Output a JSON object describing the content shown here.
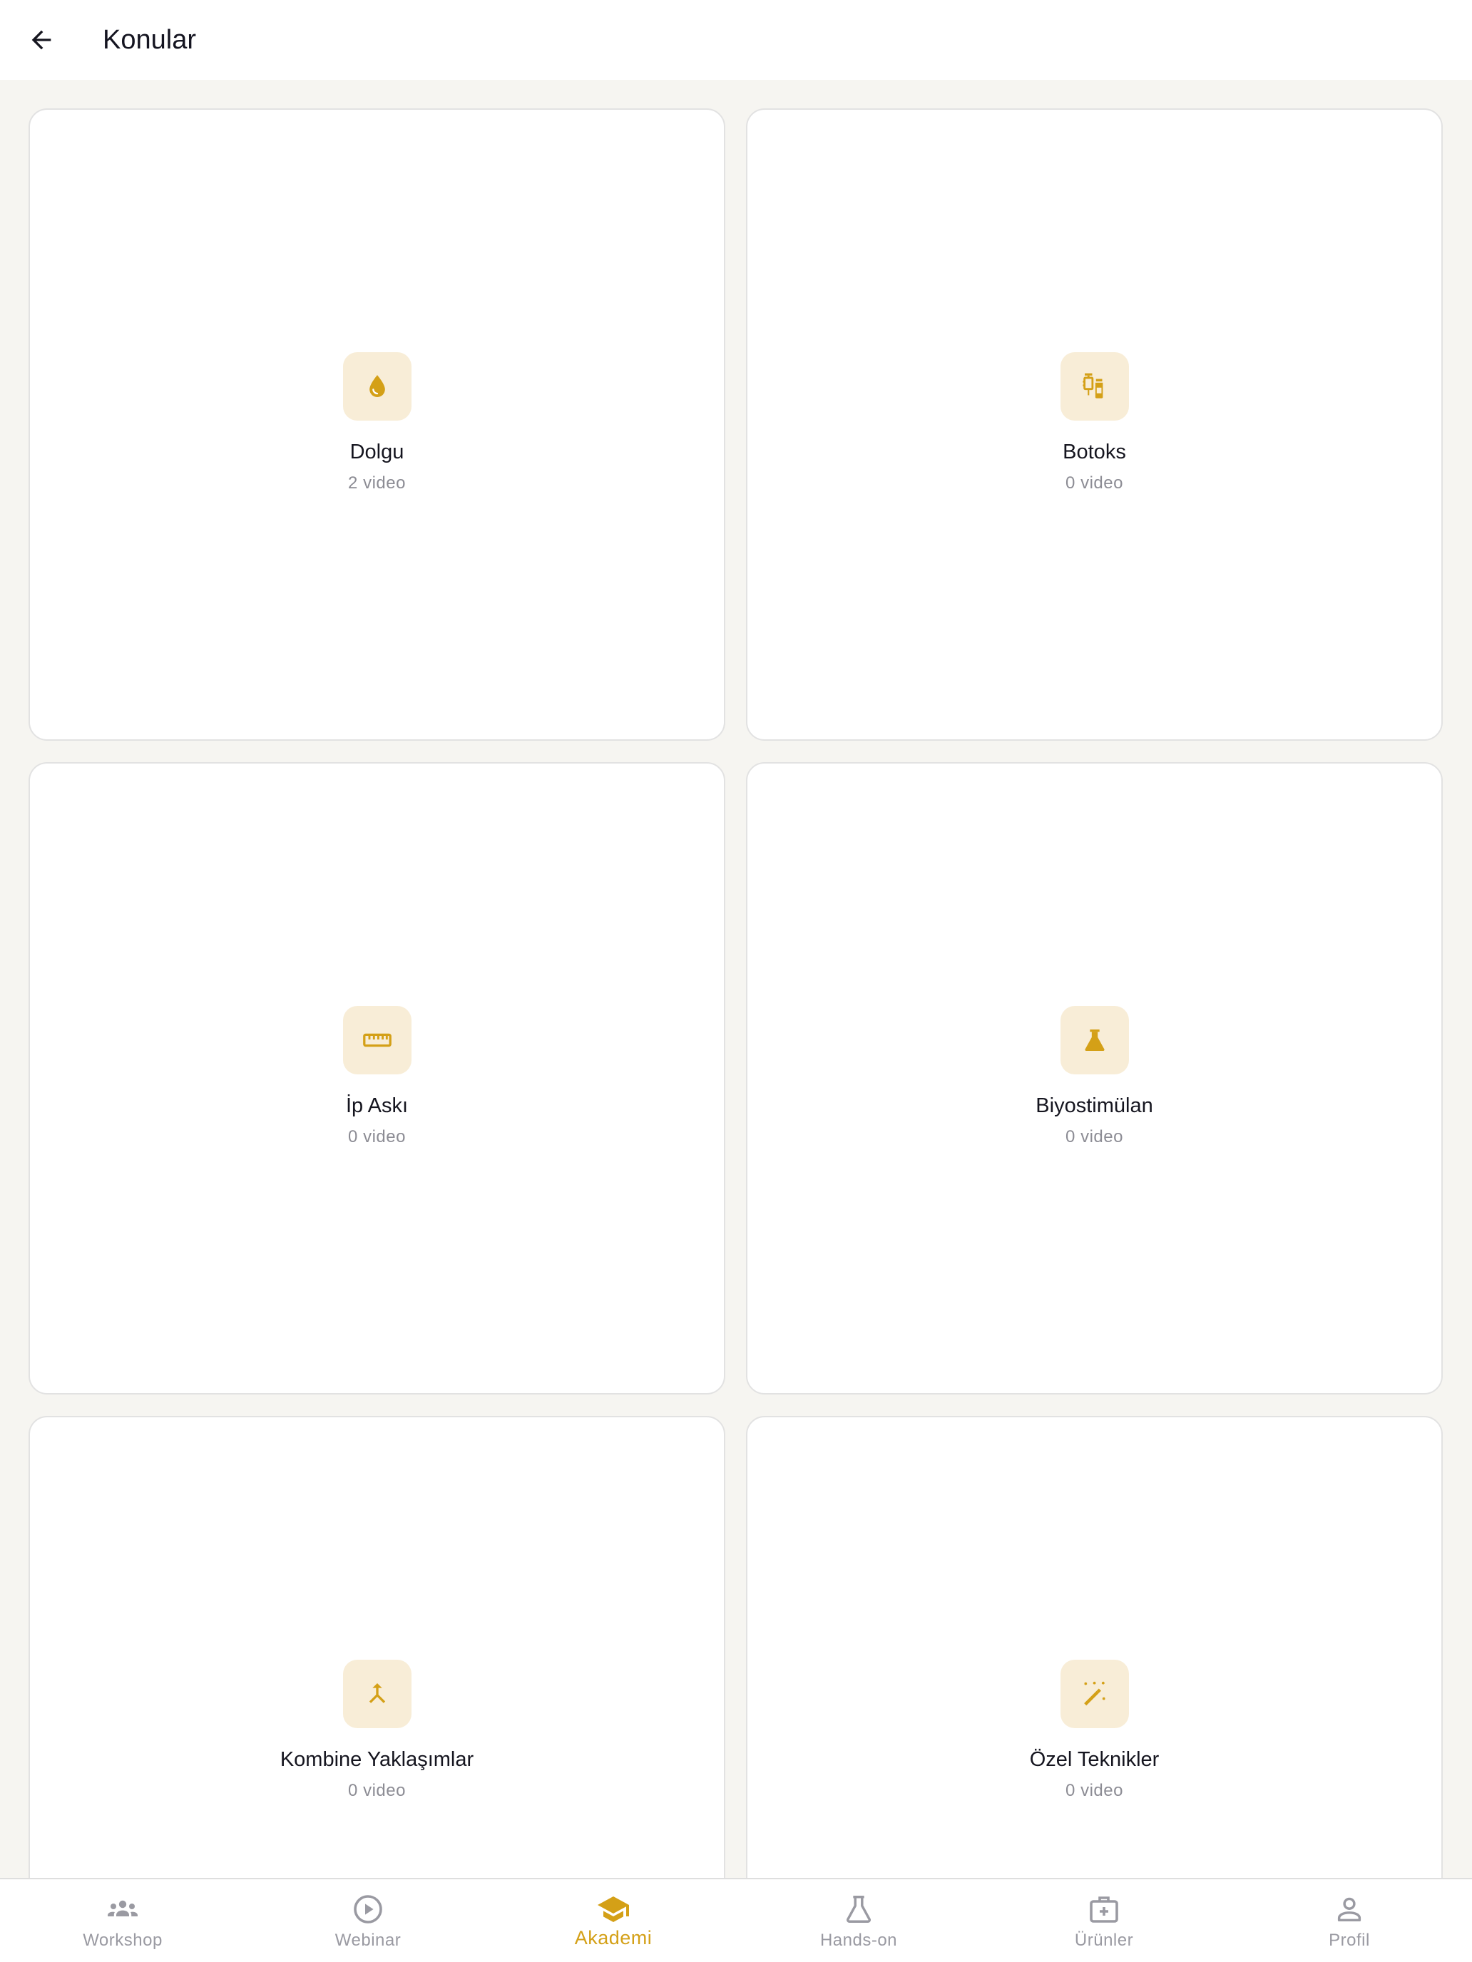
{
  "header": {
    "title": "Konular",
    "back_icon": "arrow-left-icon"
  },
  "colors": {
    "accent": "#D4A017",
    "icon_tile_bg": "#F8EDD7",
    "background": "#F6F5F1",
    "inactive": "#9A9AA2"
  },
  "topics": [
    {
      "title": "Dolgu",
      "count": "2 video",
      "icon": "water-drop-icon"
    },
    {
      "title": "Botoks",
      "count": "0 video",
      "icon": "syringe-vial-icon"
    },
    {
      "title": "İp Askı",
      "count": "0 video",
      "icon": "ruler-icon"
    },
    {
      "title": "Biyostimülan",
      "count": "0 video",
      "icon": "flask-icon"
    },
    {
      "title": "Kombine Yaklaşımlar",
      "count": "0 video",
      "icon": "merge-arrow-icon"
    },
    {
      "title": "Özel Teknikler",
      "count": "0 video",
      "icon": "magic-wand-icon"
    }
  ],
  "bottom_nav": {
    "active": "Akademi",
    "items": [
      {
        "label": "Workshop",
        "icon": "group-icon"
      },
      {
        "label": "Webinar",
        "icon": "play-circle-icon"
      },
      {
        "label": "Akademi",
        "icon": "graduation-cap-icon"
      },
      {
        "label": "Hands-on",
        "icon": "flask-icon"
      },
      {
        "label": "Ürünler",
        "icon": "medical-case-icon"
      },
      {
        "label": "Profil",
        "icon": "person-icon"
      }
    ]
  }
}
